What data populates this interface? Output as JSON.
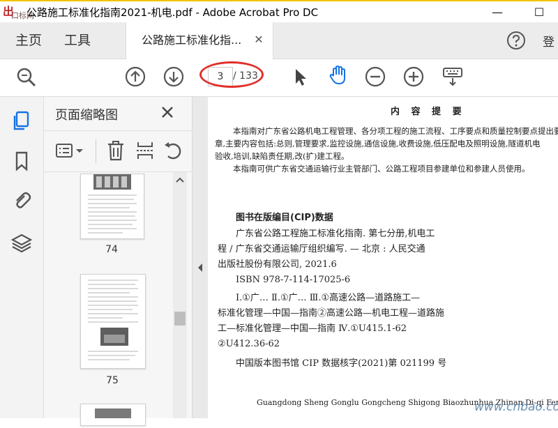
{
  "titlebar": {
    "app_icon_char": "出",
    "watermark_top": "口标网",
    "title": "公路施工标准化指南2021-机电.pdf - Adobe Acrobat Pro DC",
    "minimize": "—",
    "maximize": "☐"
  },
  "nav": {
    "home": "主页",
    "tools": "工具",
    "doc_tab": "公路施工标准化指...",
    "doc_tab_close": "✕",
    "login": "登"
  },
  "toolbar": {
    "current_page": "3",
    "total_pages": "/ 133"
  },
  "thumbnails": {
    "title": "页面缩略图",
    "pages": [
      {
        "label": "74"
      },
      {
        "label": "75"
      }
    ]
  },
  "document": {
    "heading": "内 容 提 要",
    "summary_lines": [
      "本指南对广东省公路机电工程管理、各分项工程的施工流程、工序要点和质量控制要点提出要",
      "章,主要内容包括:总则,管理要求,监控设施,通信设施,收费设施,低压配电及照明设施,隧道机电",
      "验收,培训,缺陷责任期,改(扩)建工程。",
      "本指南可供广东省交通运输行业主管部门、公路工程项目参建单位和参建人员使用。"
    ],
    "cip_heading": "图书在版编目(CIP)数据",
    "cip_lines": [
      "广东省公路工程施工标准化指南. 第七分册,机电工",
      "程 / 广东省交通运输厅组织编写. — 北京 : 人民交通",
      "出版社股份有限公司, 2021.6",
      "ISBN 978-7-114-17025-6",
      "Ⅰ.①广… Ⅱ.①广… Ⅲ.①高速公路—道路施工—",
      "标准化管理—中国—指南②高速公路—机电工程—道路施",
      "工—标准化管理—中国—指南 Ⅳ.①U415.1-62",
      "②U412.36-62"
    ],
    "cip_verify": "中国版本图书馆 CIP 数据核字(2021)第 021199 号",
    "pinyin_line": "Guangdong Sheng Gonglu Gongcheng Shigong Biaozhunhua Zhinan Di-qi Fence  Jidian Gong"
  },
  "footer_watermark": "www.cnbao.com",
  "colors": {
    "accent_yellow": "#f2c200",
    "highlight_red": "#e0302c",
    "icon_blue": "#1473e6"
  }
}
